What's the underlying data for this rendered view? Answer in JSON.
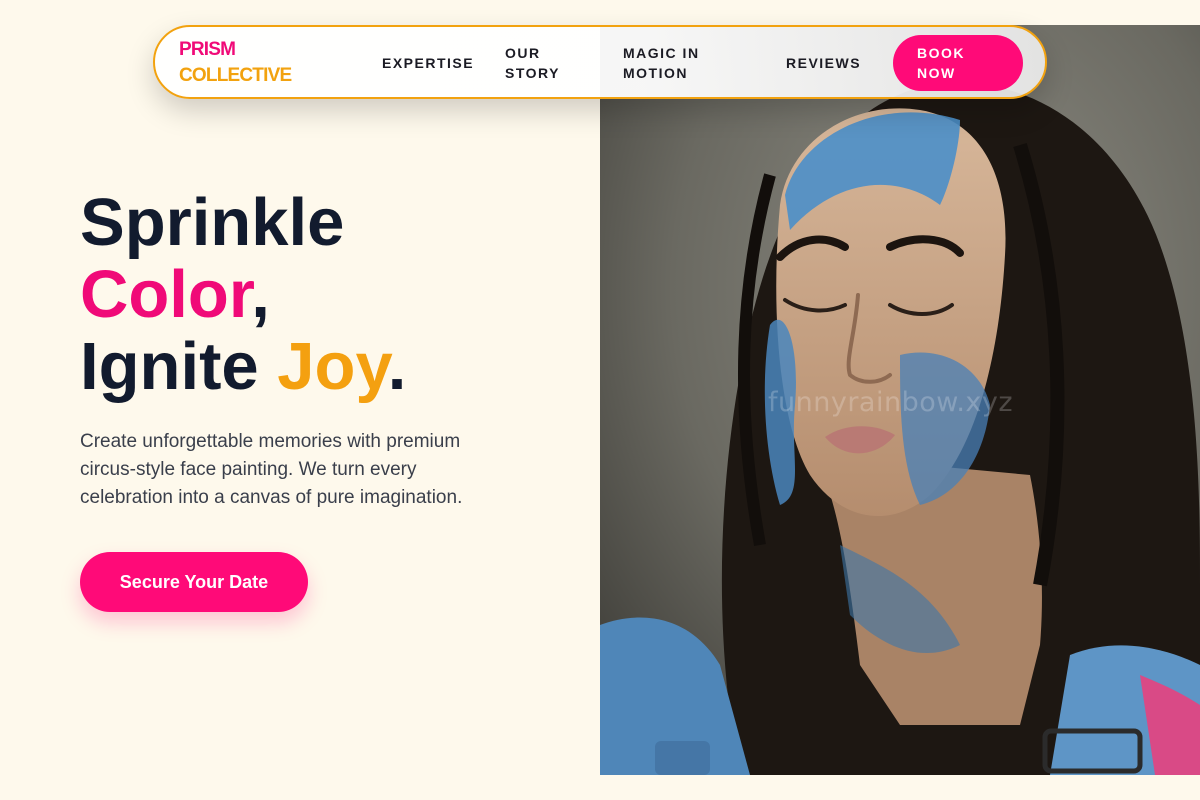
{
  "brand": {
    "line1": "PRISM",
    "line2": "COLLECTIVE"
  },
  "nav": {
    "links": [
      "EXPERTISE",
      "OUR STORY",
      "MAGIC IN MOTION",
      "REVIEWS"
    ],
    "cta": "BOOK NOW"
  },
  "hero": {
    "headline": {
      "line1": "Sprinkle",
      "color_word": "Color",
      "comma": ",",
      "ignite": "Ignite ",
      "joy_word": "Joy",
      "period": "."
    },
    "subtext": "Create unforgettable memories with premium circus-style face painting. We turn every celebration into a canvas of pure imagination.",
    "cta": "Secure Your Date",
    "watermark": "funnyrainbow.xyz",
    "image_icon": "portrait-photo"
  },
  "colors": {
    "background": "#fef9ec",
    "accent_pink": "#ff0a78",
    "accent_gold": "#f2a20f",
    "text_dark": "#121b2e"
  }
}
